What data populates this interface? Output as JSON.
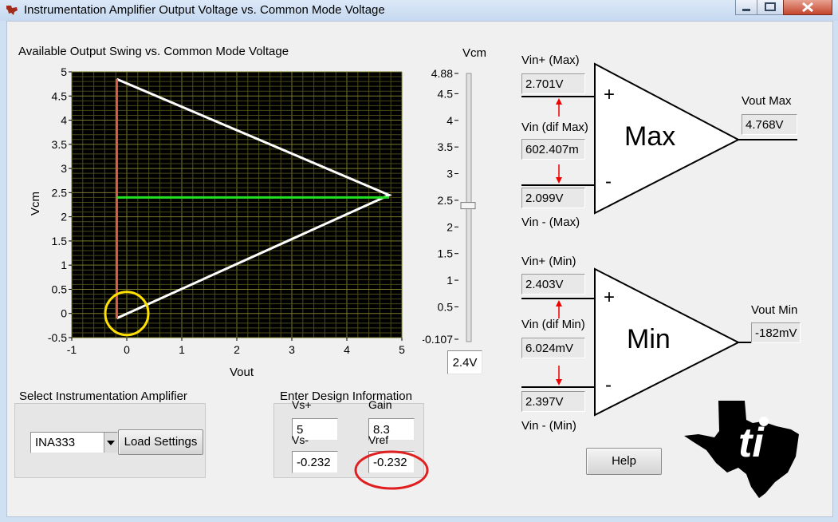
{
  "window": {
    "title": "Instrumentation Amplifier Output Voltage vs. Common Mode Voltage",
    "minimize_icon": "minimize-icon",
    "maximize_icon": "maximize-icon",
    "close_icon": "close-icon"
  },
  "graph": {
    "title": "Available Output Swing vs. Common Mode Voltage",
    "xlabel": "Vout",
    "ylabel": "Vcm",
    "xticks": [
      "-1",
      "0",
      "1",
      "2",
      "3",
      "4",
      "5"
    ],
    "yticks": [
      "5",
      "4.5",
      "4",
      "3.5",
      "3",
      "2.5",
      "2",
      "1.5",
      "1",
      "0.5",
      "0",
      "-0.5"
    ]
  },
  "chart_data": {
    "type": "line",
    "title": "Available Output Swing vs. Common Mode Voltage",
    "xlabel": "Vout",
    "ylabel": "Vcm",
    "xlim": [
      -1,
      5
    ],
    "ylim": [
      -0.5,
      5
    ],
    "grid": true,
    "series": [
      {
        "color": "#ffffff",
        "x": [
          -0.182,
          4.768,
          -0.182
        ],
        "y": [
          4.85,
          2.45,
          -0.1
        ]
      },
      {
        "color": "#e05a4a",
        "x": [
          -0.182,
          -0.182
        ],
        "y": [
          4.85,
          -0.1
        ]
      },
      {
        "color": "#22e022",
        "x": [
          -0.182,
          4.768
        ],
        "y": [
          2.4,
          2.4
        ]
      }
    ],
    "annotations": [
      {
        "shape": "circle",
        "color": "#ffe000",
        "x": 0,
        "y": 0
      }
    ]
  },
  "slider": {
    "label": "Vcm",
    "max_label": "4.88",
    "min_label": "-0.107",
    "ticks": [
      "4.5",
      "4",
      "3.5",
      "3",
      "2.5",
      "2",
      "1.5",
      "1",
      "0.5"
    ],
    "value": 2.4,
    "value_text": "2.4V"
  },
  "max_section": {
    "vin_plus_label": "Vin+ (Max)",
    "vin_plus_value": "2.701V",
    "vin_dif_label": "Vin (dif Max)",
    "vin_dif_value": "602.407m",
    "vin_minus_value": "2.099V",
    "vin_minus_label": "Vin - (Max)",
    "amp_label": "Max",
    "plus_sign": "+",
    "minus_sign": "-",
    "vout_label": "Vout Max",
    "vout_value": "4.768V"
  },
  "min_section": {
    "vin_plus_label": "Vin+ (Min)",
    "vin_plus_value": "2.403V",
    "vin_dif_label": "Vin (dif Min)",
    "vin_dif_value": "6.024mV",
    "vin_minus_value": "2.397V",
    "vin_minus_label": "Vin - (Min)",
    "amp_label": "Min",
    "plus_sign": "+",
    "minus_sign": "-",
    "vout_label": "Vout Min",
    "vout_value": "-182mV"
  },
  "select_amp": {
    "label": "Select Instrumentation Amplifier",
    "selected": "INA333",
    "load_button": "Load Settings"
  },
  "design": {
    "label": "Enter Design Information",
    "vs_plus_label": "Vs+",
    "vs_plus_value": "5",
    "gain_label": "Gain",
    "gain_value": "8.3",
    "vs_minus_label": "Vs-",
    "vs_minus_value": "-0.232",
    "vref_label": "Vref",
    "vref_value": "-0.232"
  },
  "help_button": "Help",
  "logo_icon": "ti-texas-logo-icon"
}
